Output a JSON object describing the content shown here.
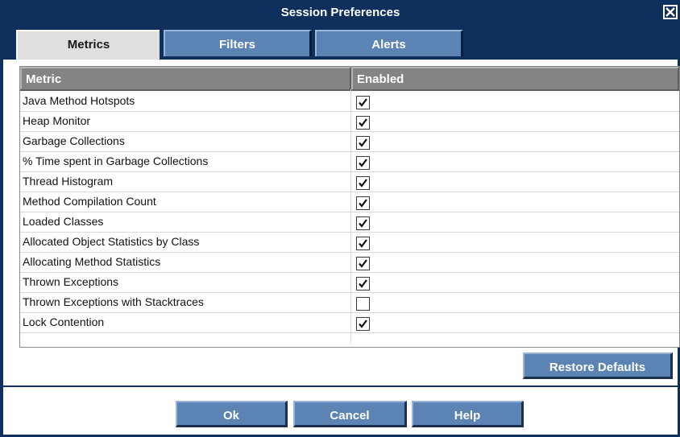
{
  "window": {
    "title": "Session Preferences"
  },
  "tabs": [
    {
      "label": "Metrics",
      "active": true
    },
    {
      "label": "Filters",
      "active": false
    },
    {
      "label": "Alerts",
      "active": false
    }
  ],
  "table": {
    "columns": [
      "Metric",
      "Enabled"
    ],
    "rows": [
      {
        "name": "Java Method Hotspots",
        "enabled": true
      },
      {
        "name": "Heap Monitor",
        "enabled": true
      },
      {
        "name": "Garbage Collections",
        "enabled": true
      },
      {
        "name": "% Time spent in Garbage Collections",
        "enabled": true
      },
      {
        "name": "Thread Histogram",
        "enabled": true
      },
      {
        "name": "Method Compilation Count",
        "enabled": true
      },
      {
        "name": "Loaded Classes",
        "enabled": true
      },
      {
        "name": "Allocated Object Statistics by Class",
        "enabled": true
      },
      {
        "name": "Allocating Method Statistics",
        "enabled": true
      },
      {
        "name": "Thrown Exceptions",
        "enabled": true
      },
      {
        "name": "Thrown Exceptions with Stacktraces",
        "enabled": false
      },
      {
        "name": "Lock Contention",
        "enabled": true
      }
    ]
  },
  "buttons": {
    "restore_defaults": "Restore Defaults",
    "ok": "Ok",
    "cancel": "Cancel",
    "help": "Help"
  },
  "icons": {
    "close": "close-icon",
    "check": "checkmark-icon"
  },
  "colors": {
    "titlebar": "#0f2f5c",
    "button": "#5b83b3",
    "header": "#848484",
    "active_tab": "#dfdfdf"
  }
}
